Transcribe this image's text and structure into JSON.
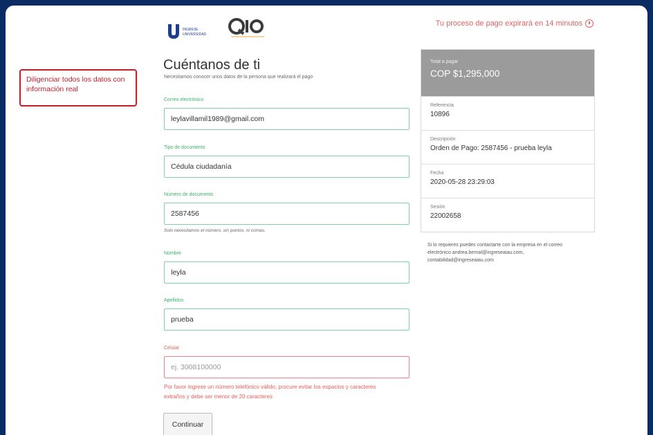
{
  "header": {
    "logo_u_text": "INGRESE UNIVERSIDAD",
    "logo_q_text": "QIO",
    "timer_text": "Tu proceso de pago expirará en 14 minutos"
  },
  "note": {
    "text": "Diligenciar todos los datos con información real"
  },
  "form": {
    "title": "Cuéntanos de ti",
    "subtitle": "Necesitamos conocer unos datos de la persona que realizará el pago",
    "email": {
      "label": "Correo electrónico",
      "value": "leylavillamil1989@gmail.com"
    },
    "doc_type": {
      "label": "Tipo de documento",
      "value": "Cédula ciudadanía"
    },
    "doc_number": {
      "label": "Número de documento",
      "value": "2587456",
      "help": "Solo necesitamos el número, sin puntos, ni comas."
    },
    "first_name": {
      "label": "Nombre",
      "value": "leyla"
    },
    "last_name": {
      "label": "Apellidos",
      "value": "prueba"
    },
    "phone": {
      "label": "Celular",
      "placeholder": "ej. 3008100000",
      "error": "Por favor ingrese un número telefónico válido, procure evitar los espacios y caracteres extraños y debe ser menor de 20 caracteres"
    },
    "submit_label": "Continuar"
  },
  "summary": {
    "total_label": "Total a pagar",
    "total_value": "COP $1,295,000",
    "rows": [
      {
        "label": "Referencia",
        "value": "10896"
      },
      {
        "label": "Descripción",
        "value": "Orden de Pago: 2587456 - prueba leyla"
      },
      {
        "label": "Fecha",
        "value": "2020-05-28 23:29:03"
      },
      {
        "label": "Sesión",
        "value": "22002658"
      }
    ],
    "contact_text": "Si lo requieres puedes contactarte con la empresa en el correo electrónico andrea.bernal@ingreseaiau.com, contabilidad@ingreseaiau.com"
  },
  "colors": {
    "background": "#0b2c63",
    "accent_green": "#38b26a",
    "error_red": "#e4605e",
    "note_red": "#c21f2c"
  }
}
